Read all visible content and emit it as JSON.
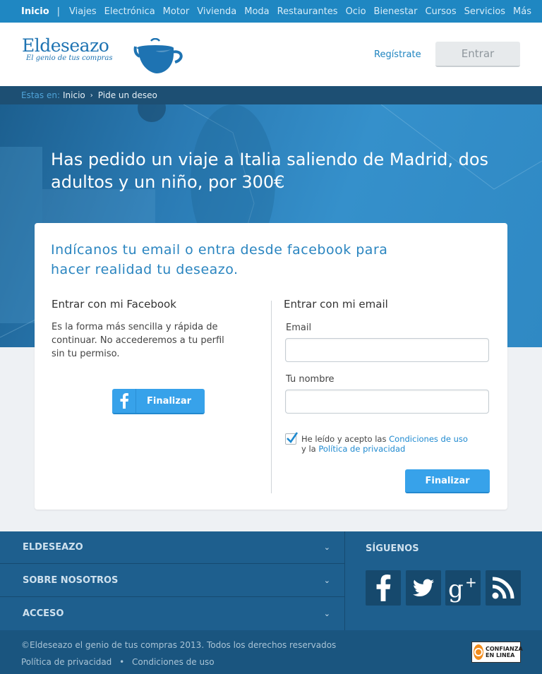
{
  "topnav": {
    "items": [
      "Inicio",
      "Viajes",
      "Electrónica",
      "Motor",
      "Vivienda",
      "Moda",
      "Restaurantes",
      "Ocio",
      "Bienestar",
      "Cursos",
      "Servicios",
      "Más"
    ]
  },
  "header": {
    "logo_text": "Eldeseazo",
    "logo_tagline": "El genio de tus compras",
    "register_label": "Regístrate",
    "login_label": "Entrar"
  },
  "breadcrumb": {
    "prefix": "Estas en:",
    "items": [
      "Inicio",
      "Pide un deseo"
    ]
  },
  "hero": {
    "title": "Has pedido un viaje a Italia saliendo de Madrid, dos adultos y un niño, por 300€"
  },
  "card": {
    "intro": "Indícanos tu email o entra desde facebook para hacer realidad tu deseazo.",
    "facebook": {
      "title": "Entrar con mi Facebook",
      "text": "Es la forma más sencilla y rápida de continuar. No accederemos a tu perfil sin tu permiso.",
      "button_label": "Finalizar"
    },
    "email": {
      "title": "Entrar con mi email",
      "email_label": "Email",
      "email_value": "",
      "name_label": "Tu nombre",
      "name_value": "",
      "terms_checked": true,
      "terms_prefix": "He leído y acepto las",
      "terms_link": "Condiciones de uso",
      "terms_mid": "y la",
      "privacy_link": "Política de privacidad",
      "button_label": "Finalizar"
    }
  },
  "footer": {
    "accordion": [
      "ELDESEAZO",
      "SOBRE NOSOTROS",
      "ACCESO"
    ],
    "follow_title": "SÍGUENOS",
    "social": [
      "facebook-icon",
      "twitter-icon",
      "google-plus-icon",
      "rss-icon"
    ],
    "copyright": "©Eldeseazo el genio de tus compras 2013. Todos los derechos reservados",
    "legal_links": [
      "Política de privacidad",
      "Condiciones de uso"
    ],
    "badge_text": "CONFIANZA EN LINEA"
  },
  "colors": {
    "accent": "#37a2ea",
    "nav_blue": "#1f87c2",
    "footer_blue": "#1e5f8e"
  }
}
